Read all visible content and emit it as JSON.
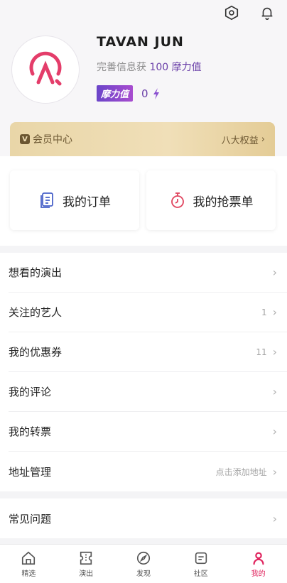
{
  "header": {
    "username": "TAVAN JUN",
    "completion_prefix": "完善信息获",
    "completion_value": "100 摩力值",
    "moli_tag": "摩力值",
    "moli_value": "0"
  },
  "vip": {
    "badge": "V",
    "label": "会员中心",
    "benefits": "八大权益"
  },
  "orders": {
    "my_orders": "我的订单",
    "my_ticket_grabs": "我的抢票单"
  },
  "list_group_1": [
    {
      "label": "想看的演出",
      "value": ""
    },
    {
      "label": "关注的艺人",
      "value": "1"
    },
    {
      "label": "我的优惠券",
      "value": "11"
    },
    {
      "label": "我的评论",
      "value": ""
    },
    {
      "label": "我的转票",
      "value": ""
    },
    {
      "label": "地址管理",
      "value": "点击添加地址"
    }
  ],
  "list_group_2": [
    {
      "label": "常见问题",
      "value": ""
    }
  ],
  "tabbar": {
    "tabs": [
      {
        "label": "精选",
        "icon": "home-icon"
      },
      {
        "label": "演出",
        "icon": "ticket-icon"
      },
      {
        "label": "发现",
        "icon": "compass-icon"
      },
      {
        "label": "社区",
        "icon": "community-icon"
      },
      {
        "label": "我的",
        "icon": "profile-icon"
      }
    ],
    "active_index": 4
  },
  "colors": {
    "accent": "#e0245e",
    "purple": "#6a3fa8",
    "gold": "#e9d6a8"
  }
}
